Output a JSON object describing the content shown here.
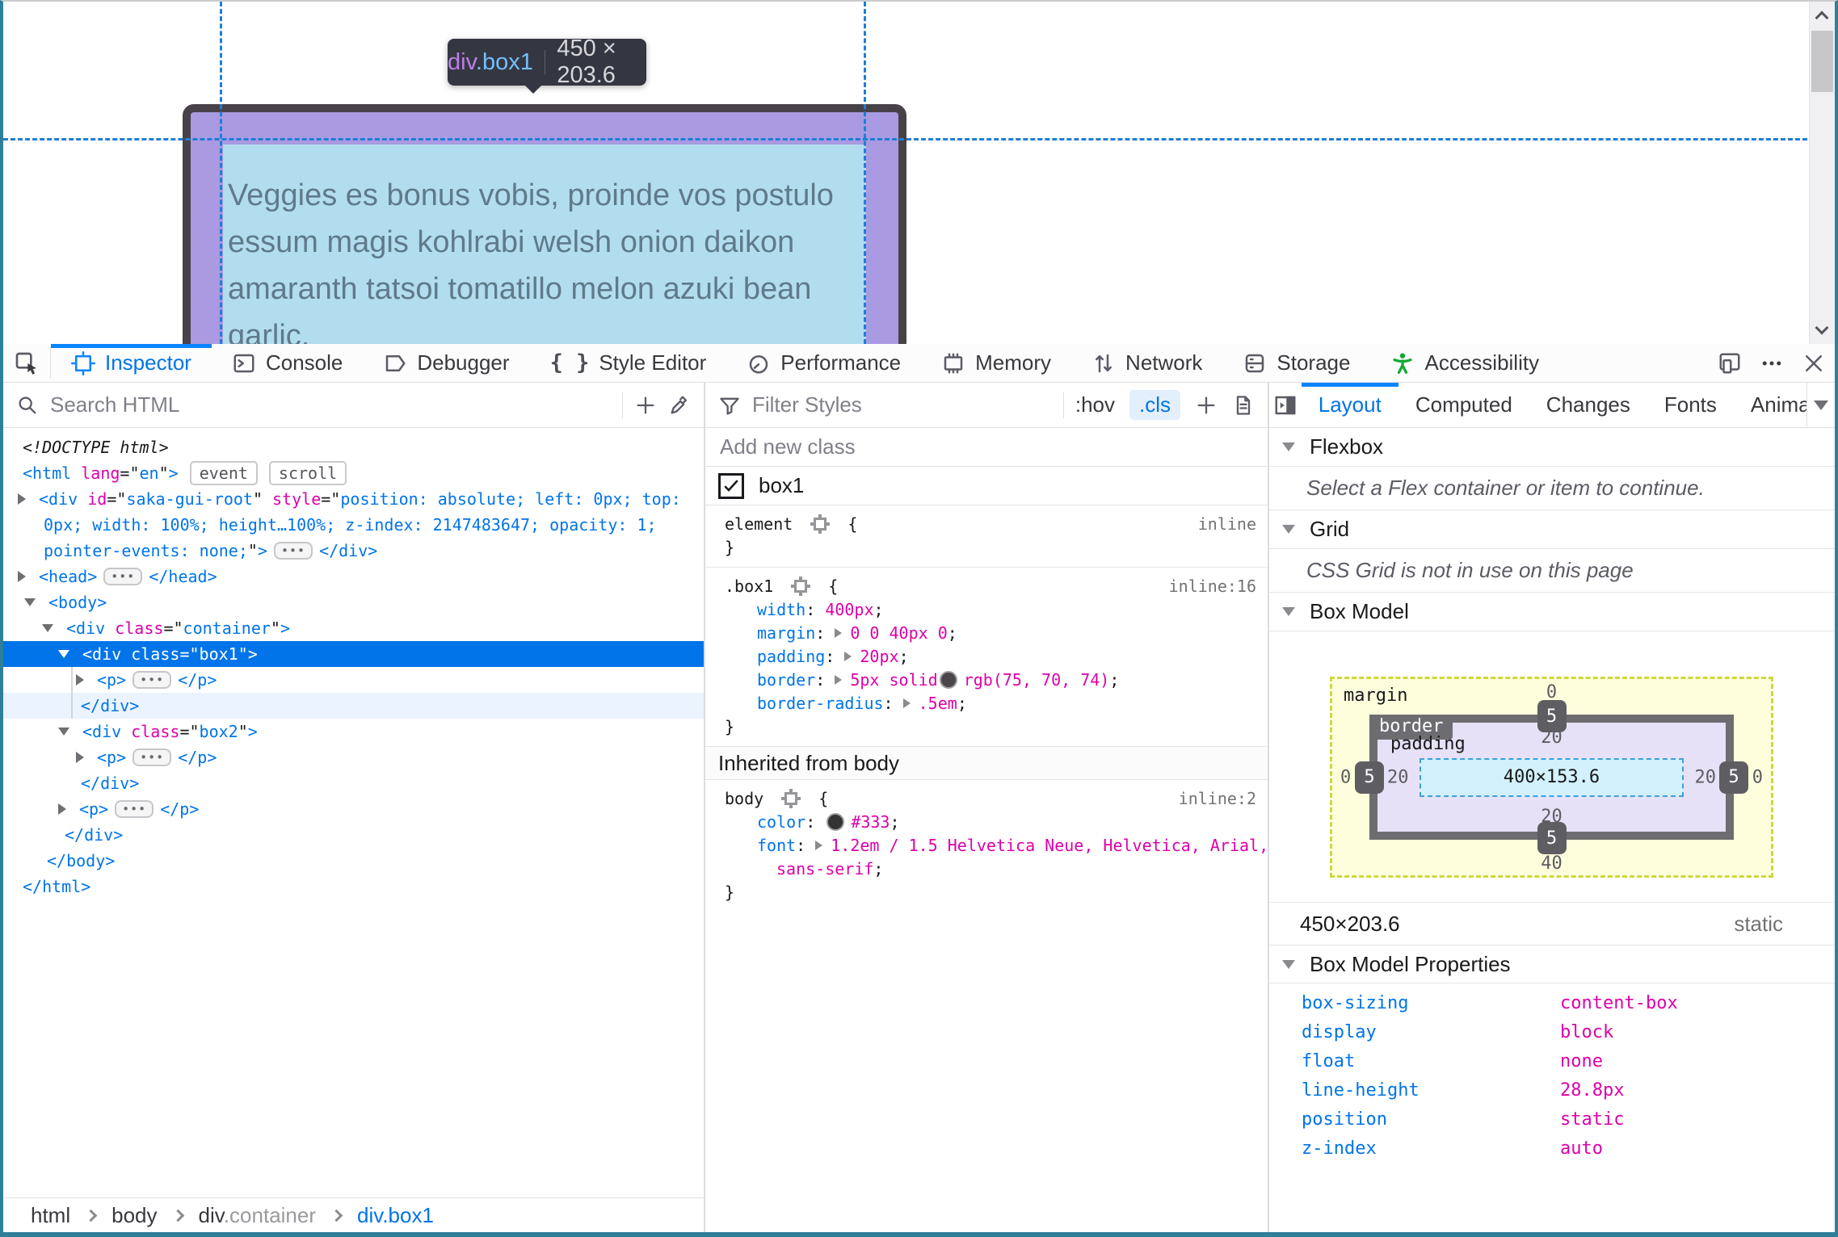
{
  "page": {
    "tooltip": {
      "tag": "div",
      "cls": ".box1",
      "dims": "450 × 203.6"
    },
    "text_lines": [
      "Veggies es bonus vobis, proinde vos postulo",
      "essum magis kohlrabi welsh onion daikon",
      "amaranth tatsoi tomatillo melon azuki bean",
      "garlic."
    ]
  },
  "toolbar": {
    "tabs": [
      {
        "label": "Inspector"
      },
      {
        "label": "Console"
      },
      {
        "label": "Debugger"
      },
      {
        "label": "Style Editor"
      },
      {
        "label": "Performance"
      },
      {
        "label": "Memory"
      },
      {
        "label": "Network"
      },
      {
        "label": "Storage"
      },
      {
        "label": "Accessibility"
      }
    ]
  },
  "left": {
    "search_placeholder": "Search HTML",
    "breadcrumb": {
      "c1": "html",
      "c2": "body",
      "c3a": "div",
      "c3b": ".container",
      "c4": "div.box1"
    }
  },
  "markup": {
    "lines": [
      {
        "pl": 24,
        "tokens": [
          {
            "t": "<!DOCTYPE html>",
            "c": "doc"
          }
        ]
      },
      {
        "pl": 24,
        "tokens": [
          {
            "t": "<html ",
            "c": "tag"
          },
          {
            "t": "lang",
            "c": "attr"
          },
          {
            "t": "=\"",
            "c": "punc"
          },
          {
            "t": "en",
            "c": "val"
          },
          {
            "t": "\"",
            "c": "punc"
          },
          {
            "t": ">",
            "c": "tag"
          },
          {
            "k": "badge",
            "t": "event"
          },
          {
            "k": "badge",
            "t": "scroll"
          }
        ]
      },
      {
        "pl": 18,
        "tw": "c",
        "tokens": [
          {
            "t": "<div ",
            "c": "tag"
          },
          {
            "t": "id",
            "c": "attr"
          },
          {
            "t": "=\"",
            "c": "punc"
          },
          {
            "t": "saka-gui-root",
            "c": "val"
          },
          {
            "t": "\" ",
            "c": "punc"
          },
          {
            "t": "style",
            "c": "attr"
          },
          {
            "t": "=\"",
            "c": "punc"
          },
          {
            "t": "position: absolute; left: 0px; top:",
            "c": "val"
          }
        ]
      },
      {
        "pl": 50,
        "tokens": [
          {
            "t": "0px; width: 100%; height…100%; z-index: 2147483647; opacity: 1;",
            "c": "val"
          }
        ]
      },
      {
        "pl": 50,
        "tokens": [
          {
            "t": "pointer-events: none;",
            "c": "val"
          },
          {
            "t": "\"",
            "c": "punc"
          },
          {
            "t": ">",
            "c": "tag"
          },
          {
            "k": "dots"
          },
          {
            "t": "</div>",
            "c": "tag"
          }
        ]
      },
      {
        "pl": 18,
        "tw": "c",
        "tokens": [
          {
            "t": "<head>",
            "c": "tag"
          },
          {
            "k": "dots"
          },
          {
            "t": "</head>",
            "c": "tag"
          }
        ]
      },
      {
        "pl": 26,
        "tw": "o",
        "tokens": [
          {
            "t": "<body>",
            "c": "tag"
          }
        ]
      },
      {
        "pl": 48,
        "tw": "o",
        "tokens": [
          {
            "t": "<div ",
            "c": "tag"
          },
          {
            "t": "class",
            "c": "attr"
          },
          {
            "t": "=\"",
            "c": "punc"
          },
          {
            "t": "container",
            "c": "val"
          },
          {
            "t": "\"",
            "c": "punc"
          },
          {
            "t": ">",
            "c": "tag"
          }
        ]
      },
      {
        "pl": 68,
        "tw": "o",
        "state": "selected",
        "tokens": [
          {
            "t": "<div ",
            "c": "tag"
          },
          {
            "t": "class",
            "c": "attr"
          },
          {
            "t": "=\"",
            "c": "punc"
          },
          {
            "t": "box1",
            "c": "val"
          },
          {
            "t": "\"",
            "c": "punc"
          },
          {
            "t": ">",
            "c": "tag"
          }
        ]
      },
      {
        "pl": 90,
        "tw": "c",
        "gx": 84,
        "tokens": [
          {
            "t": "<p>",
            "c": "tag"
          },
          {
            "k": "dots"
          },
          {
            "t": "</p>",
            "c": "tag"
          }
        ]
      },
      {
        "pl": 96,
        "state": "childlite",
        "gx": 84,
        "tokens": [
          {
            "t": "</div>",
            "c": "tag"
          }
        ]
      },
      {
        "pl": 68,
        "tw": "o",
        "tokens": [
          {
            "t": "<div ",
            "c": "tag"
          },
          {
            "t": "class",
            "c": "attr"
          },
          {
            "t": "=\"",
            "c": "punc"
          },
          {
            "t": "box2",
            "c": "val"
          },
          {
            "t": "\"",
            "c": "punc"
          },
          {
            "t": ">",
            "c": "tag"
          }
        ]
      },
      {
        "pl": 90,
        "tw": "c",
        "tokens": [
          {
            "t": "<p>",
            "c": "tag"
          },
          {
            "k": "dots"
          },
          {
            "t": "</p>",
            "c": "tag"
          }
        ]
      },
      {
        "pl": 96,
        "tokens": [
          {
            "t": "</div>",
            "c": "tag"
          }
        ]
      },
      {
        "pl": 68,
        "tw": "c",
        "tokens": [
          {
            "t": "<p>",
            "c": "tag"
          },
          {
            "k": "dots"
          },
          {
            "t": "</p>",
            "c": "tag"
          }
        ]
      },
      {
        "pl": 76,
        "tokens": [
          {
            "t": "</div>",
            "c": "tag"
          }
        ]
      },
      {
        "pl": 54,
        "tokens": [
          {
            "t": "</body>",
            "c": "tag"
          }
        ]
      },
      {
        "pl": 24,
        "tokens": [
          {
            "t": "</html>",
            "c": "tag"
          }
        ]
      }
    ]
  },
  "rules": {
    "filter_placeholder": "Filter Styles",
    "hov": ":hov",
    "cls": ".cls",
    "add_class_placeholder": "Add new class",
    "class_name": "box1",
    "inherited": "Inherited from body",
    "element_block": [
      {
        "pl": 12,
        "right": "inline",
        "tokens": [
          {
            "t": "element ",
            "c": "sel"
          },
          {
            "k": "target"
          },
          {
            "t": " {",
            "c": "sel"
          }
        ]
      },
      {
        "pl": 12,
        "tokens": [
          {
            "t": "}",
            "c": "sel"
          }
        ]
      }
    ],
    "box1_block": [
      {
        "pl": 12,
        "right": "inline:16",
        "tokens": [
          {
            "t": ".box1 ",
            "c": "sel"
          },
          {
            "k": "target"
          },
          {
            "t": " {",
            "c": "sel"
          }
        ]
      },
      {
        "pl": 52,
        "tokens": [
          {
            "t": "width",
            "c": "prop"
          },
          {
            "t": ": ",
            "c": "sel"
          },
          {
            "t": "400px",
            "c": "pv"
          },
          {
            "t": ";",
            "c": "sel"
          }
        ]
      },
      {
        "pl": 52,
        "tokens": [
          {
            "t": "margin",
            "c": "prop"
          },
          {
            "t": ": ",
            "c": "sel"
          },
          {
            "k": "arrow"
          },
          {
            "t": "0 0 40px 0",
            "c": "pv"
          },
          {
            "t": ";",
            "c": "sel"
          }
        ]
      },
      {
        "pl": 52,
        "tokens": [
          {
            "t": "padding",
            "c": "prop"
          },
          {
            "t": ": ",
            "c": "sel"
          },
          {
            "k": "arrow"
          },
          {
            "t": "20px",
            "c": "pv"
          },
          {
            "t": ";",
            "c": "sel"
          }
        ]
      },
      {
        "pl": 52,
        "tokens": [
          {
            "t": "border",
            "c": "prop"
          },
          {
            "t": ": ",
            "c": "sel"
          },
          {
            "k": "arrow"
          },
          {
            "t": "5px solid",
            "c": "pv"
          },
          {
            "k": "swatch",
            "color": "#4b464a"
          },
          {
            "t": "rgb(75, 70, 74)",
            "c": "pv"
          },
          {
            "t": ";",
            "c": "sel"
          }
        ]
      },
      {
        "pl": 52,
        "tokens": [
          {
            "t": "border-radius",
            "c": "prop"
          },
          {
            "t": ": ",
            "c": "sel"
          },
          {
            "k": "arrow"
          },
          {
            "t": ".5em",
            "c": "pv"
          },
          {
            "t": ";",
            "c": "sel"
          }
        ]
      },
      {
        "pl": 12,
        "tokens": [
          {
            "t": "}",
            "c": "sel"
          }
        ]
      }
    ],
    "body_block": [
      {
        "pl": 12,
        "right": "inline:2",
        "tokens": [
          {
            "t": "body ",
            "c": "sel"
          },
          {
            "k": "target"
          },
          {
            "t": " {",
            "c": "sel"
          }
        ]
      },
      {
        "pl": 52,
        "tokens": [
          {
            "t": "color",
            "c": "prop"
          },
          {
            "t": ": ",
            "c": "sel"
          },
          {
            "k": "swatch",
            "color": "#333333"
          },
          {
            "t": "#333",
            "c": "pv"
          },
          {
            "t": ";",
            "c": "sel"
          }
        ]
      },
      {
        "pl": 52,
        "tokens": [
          {
            "t": "font",
            "c": "prop"
          },
          {
            "t": ": ",
            "c": "sel"
          },
          {
            "k": "arrow"
          },
          {
            "t": "1.2em / 1.5 Helvetica Neue, Helvetica, Arial,",
            "c": "pv"
          }
        ]
      },
      {
        "pl": 76,
        "tokens": [
          {
            "t": "sans-serif",
            "c": "pv"
          },
          {
            "t": ";",
            "c": "sel"
          }
        ]
      },
      {
        "pl": 12,
        "tokens": [
          {
            "t": "}",
            "c": "sel"
          }
        ]
      }
    ]
  },
  "layout": {
    "tabs": [
      "Layout",
      "Computed",
      "Changes",
      "Fonts",
      "Animati"
    ],
    "sections": {
      "flexbox": "Flexbox",
      "flexbox_msg": "Select a Flex container or item to continue.",
      "grid": "Grid",
      "grid_msg": "CSS Grid is not in use on this page",
      "box_model": "Box Model",
      "props_header": "Box Model Properties"
    },
    "box_model": {
      "margin_label": "margin",
      "border_label": "border",
      "padding_label": "padding",
      "content": "400×153.6",
      "m_top": "0",
      "m_left": "0",
      "m_right": "0",
      "m_bottom": "40",
      "b_top": "5",
      "b_left": "5",
      "b_right": "5",
      "b_bottom": "5",
      "p_top": "20",
      "p_left": "20",
      "p_right": "20",
      "p_bottom": "20",
      "size": "450×203.6",
      "position": "static"
    },
    "properties": [
      {
        "name": "box-sizing",
        "value": "content-box"
      },
      {
        "name": "display",
        "value": "block"
      },
      {
        "name": "float",
        "value": "none"
      },
      {
        "name": "line-height",
        "value": "28.8px"
      },
      {
        "name": "position",
        "value": "static"
      },
      {
        "name": "z-index",
        "value": "auto"
      }
    ]
  }
}
